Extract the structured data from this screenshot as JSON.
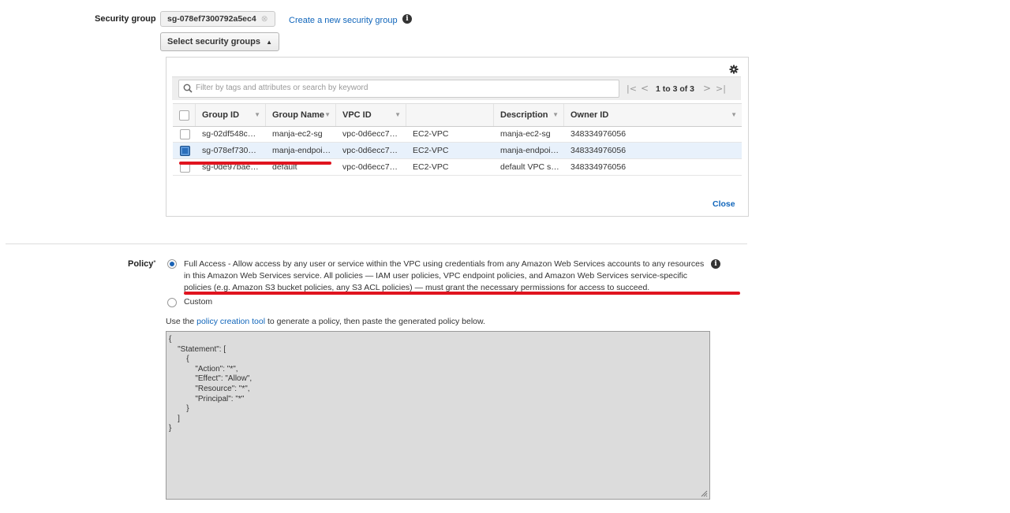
{
  "security_group": {
    "label": "Security group",
    "selected_token": "sg-078ef7300792a5ec4",
    "token_remove": "⊗",
    "create_link": "Create a new security group",
    "select_button": "Select security groups",
    "select_button_caret": "▲"
  },
  "table": {
    "filter_placeholder": "Filter by tags and attributes or search by keyword",
    "pagination": "1 to 3 of 3",
    "columns": [
      "Group ID",
      "Group Name",
      "VPC ID",
      "",
      "Description",
      "Owner ID"
    ],
    "rows": [
      {
        "checked": false,
        "group_id": "sg-02df548c…",
        "group_name": "manja-ec2-sg",
        "vpc_id": "vpc-0d6ecc7…",
        "vpc": "EC2-VPC",
        "description": "manja-ec2-sg",
        "owner_id": "348334976056"
      },
      {
        "checked": true,
        "group_id": "sg-078ef730…",
        "group_name": "manja-endpoi…",
        "vpc_id": "vpc-0d6ecc7…",
        "vpc": "EC2-VPC",
        "description": "manja-endpoi…",
        "owner_id": "348334976056"
      },
      {
        "checked": false,
        "group_id": "sg-0de97bae…",
        "group_name": "default",
        "vpc_id": "vpc-0d6ecc7…",
        "vpc": "EC2-VPC",
        "description": "default VPC s…",
        "owner_id": "348334976056"
      }
    ],
    "close_link": "Close"
  },
  "policy": {
    "label": "Policy",
    "required_mark": "*",
    "full_access_text": "Full Access - Allow access by any user or service within the VPC using credentials from any Amazon Web Services accounts to any resources in this Amazon Web Services service. All policies — IAM user policies, VPC endpoint policies, and Amazon Web Services service-specific policies (e.g. Amazon S3 bucket policies, any S3 ACL policies) — must grant the necessary permissions for access to succeed.",
    "custom_label": "Custom",
    "selected": "full_access",
    "use_prefix": "Use the",
    "tool_link": "policy creation tool",
    "use_suffix": "to generate a policy, then paste the generated policy below.",
    "document": "{\n    \"Statement\": [\n        {\n            \"Action\": \"*\",\n            \"Effect\": \"Allow\",\n            \"Resource\": \"*\",\n            \"Principal\": \"*\"\n        }\n    ]\n}"
  },
  "colors": {
    "link": "#1166bb",
    "annotation_red": "#e0141f",
    "checkbox_checked": "#2a6ebb"
  }
}
